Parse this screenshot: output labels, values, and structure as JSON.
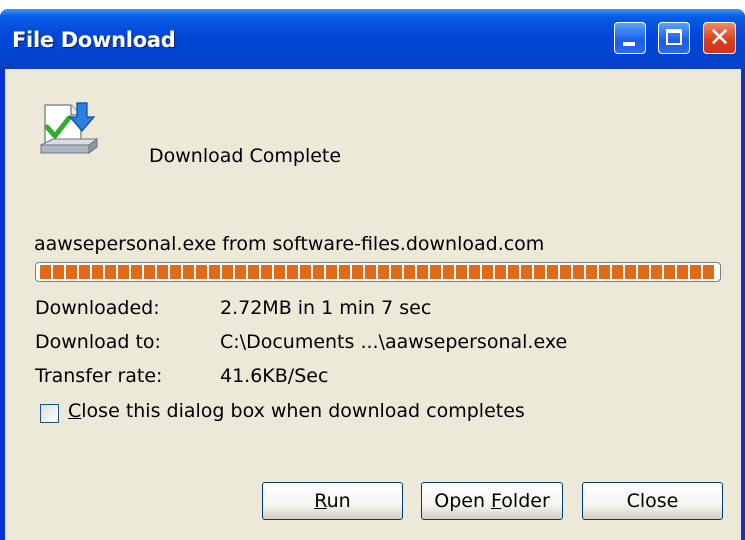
{
  "window": {
    "title": "File Download",
    "controls": [
      "minimize-icon",
      "maximize-icon",
      "close-icon"
    ]
  },
  "dialog": {
    "icon": "download-complete-icon",
    "heading": "Download Complete",
    "file_source": "aawsepersonal.exe from software-files.download.com",
    "progress_percent": 100,
    "progress_color": "#e06a18",
    "details": [
      {
        "label": "Downloaded:",
        "value": "2.72MB in 1 min 7 sec"
      },
      {
        "label": "Download to:",
        "value": "C:\\Documents ...\\aawsepersonal.exe"
      },
      {
        "label": "Transfer rate:",
        "value": "41.6KB/Sec"
      }
    ],
    "checkbox": {
      "checked": false,
      "label_first": "C",
      "label_rest": "lose this dialog box when download completes"
    },
    "buttons": {
      "run_first": "R",
      "run_rest": "un",
      "open_prefix": "Open ",
      "open_first": "F",
      "open_rest": "older",
      "close": "Close"
    }
  },
  "colors": {
    "titlebar": "#0047d8",
    "dialog_background": "#ece9d8",
    "close_button": "#d9411c"
  }
}
